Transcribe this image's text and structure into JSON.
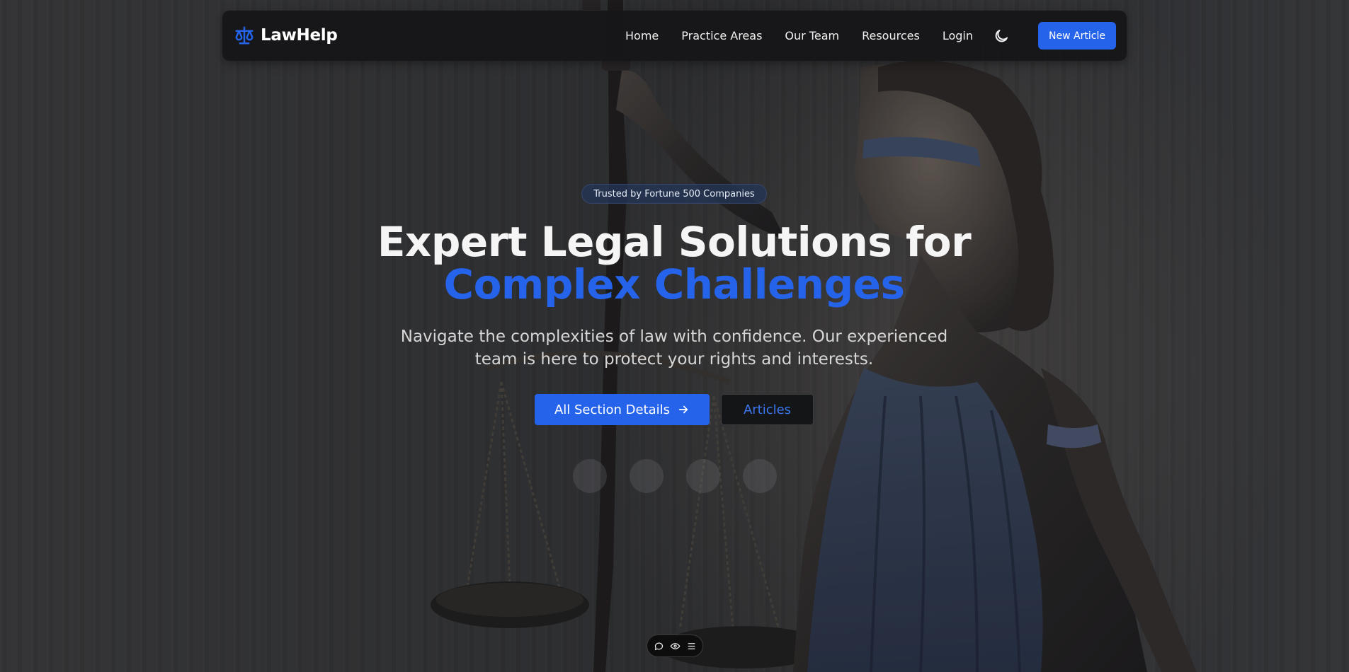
{
  "brand": {
    "name": "LawHelp",
    "icon": "scales-icon",
    "accent_color": "#2563eb"
  },
  "nav": {
    "links": [
      "Home",
      "Practice Areas",
      "Our Team",
      "Resources",
      "Login"
    ],
    "theme_toggle_icon": "moon-icon",
    "cta_label": "New Article"
  },
  "hero": {
    "badge": "Trusted by Fortune 500 Companies",
    "headline_line1": "Expert Legal Solutions for",
    "headline_line2": "Complex Challenges",
    "subtitle": "Navigate the complexities of law with confidence. Our experienced team is here to protect your rights and interests.",
    "primary_button": "All Section Details",
    "primary_button_icon": "arrow-right-icon",
    "secondary_button": "Articles",
    "background": "lady-justice-statue-image"
  },
  "floating_toolbar": {
    "icons": [
      "comment-icon",
      "eye-icon",
      "menu-icon"
    ]
  }
}
